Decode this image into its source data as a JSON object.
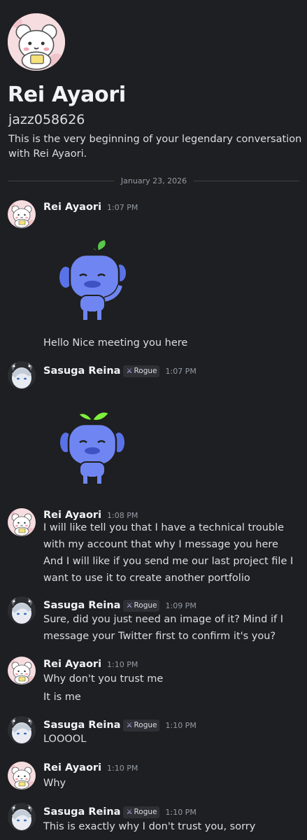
{
  "profile": {
    "display_name": "Rei Ayaori",
    "username": "jazz058626",
    "intro": "This is the very beginning of your legendary conversation with Rei Ayaori."
  },
  "divider": {
    "date": "January 23, 2026"
  },
  "role": {
    "name": "Rogue",
    "icon": "crossed-swords-icon",
    "color": "#c9b8ff"
  },
  "colors": {
    "background": "#1e1f22",
    "text": "#dbdee1",
    "muted": "#949ba4",
    "blurple": "#5865f2",
    "sprout": "#57f287"
  },
  "messages": [
    {
      "author": "Rei Ayaori",
      "time": "1:07 PM",
      "sticker": "wumpus-sprout-waving",
      "lines": [
        "Hello Nice meeting you here"
      ]
    },
    {
      "author": "Sasuga Reina",
      "role": "Rogue",
      "time": "1:07 PM",
      "sticker": "wumpus-sprout-standing",
      "lines": []
    },
    {
      "author": "Rei Ayaori",
      "time": "1:08 PM",
      "lines": [
        "I will like tell you that I have a technical trouble with my account that why I message you here",
        "And I will like if you send me our last project file I want to use it to create another portfolio"
      ]
    },
    {
      "author": "Sasuga Reina",
      "role": "Rogue",
      "time": "1:09 PM",
      "lines": [
        "Sure, did you just need an image of it? Mind if I message your Twitter first to confirm it's you?"
      ]
    },
    {
      "author": "Rei Ayaori",
      "time": "1:10 PM",
      "lines": [
        "Why don't you trust me",
        "It is me"
      ]
    },
    {
      "author": "Sasuga Reina",
      "role": "Rogue",
      "time": "1:10 PM",
      "lines": [
        "LOOOOL"
      ]
    },
    {
      "author": "Rei Ayaori",
      "time": "1:10 PM",
      "lines": [
        "Why"
      ]
    },
    {
      "author": "Sasuga Reina",
      "role": "Rogue",
      "time": "1:10 PM",
      "lines": [
        "This is exactly why I don't trust you, sorry"
      ]
    }
  ]
}
